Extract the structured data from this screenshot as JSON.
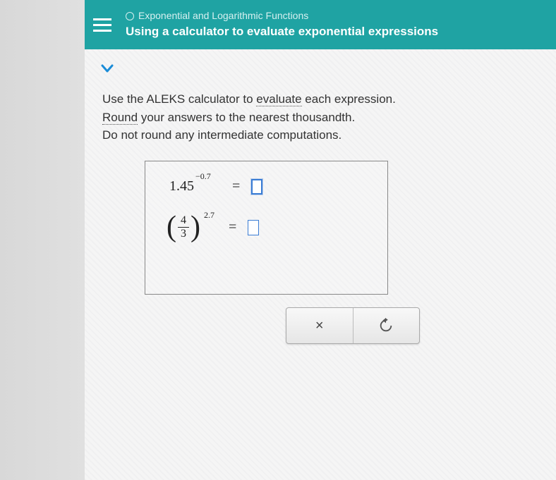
{
  "header": {
    "category": "Exponential and Logarithmic Functions",
    "title": "Using a calculator to evaluate exponential expressions"
  },
  "instructions": {
    "line1_a": "Use the ALEKS calculator to ",
    "line1_link": "evaluate",
    "line1_b": " each expression.",
    "line2_link": "Round",
    "line2_b": " your answers to the nearest thousandth.",
    "line3": "Do not round any intermediate computations."
  },
  "expressions": {
    "expr1": {
      "base": "1.45",
      "exponent": "−0.7",
      "equals": "="
    },
    "expr2": {
      "numerator": "4",
      "denominator": "3",
      "exponent": "2.7",
      "equals": "="
    }
  },
  "buttons": {
    "clear": "×",
    "reset": "↺"
  },
  "chart_data": {
    "type": "table",
    "title": "Evaluate exponential expressions (round to nearest thousandth)",
    "rows": [
      {
        "expression": "1.45^(-0.7)",
        "answer": ""
      },
      {
        "expression": "(4/3)^(2.7)",
        "answer": ""
      }
    ]
  }
}
